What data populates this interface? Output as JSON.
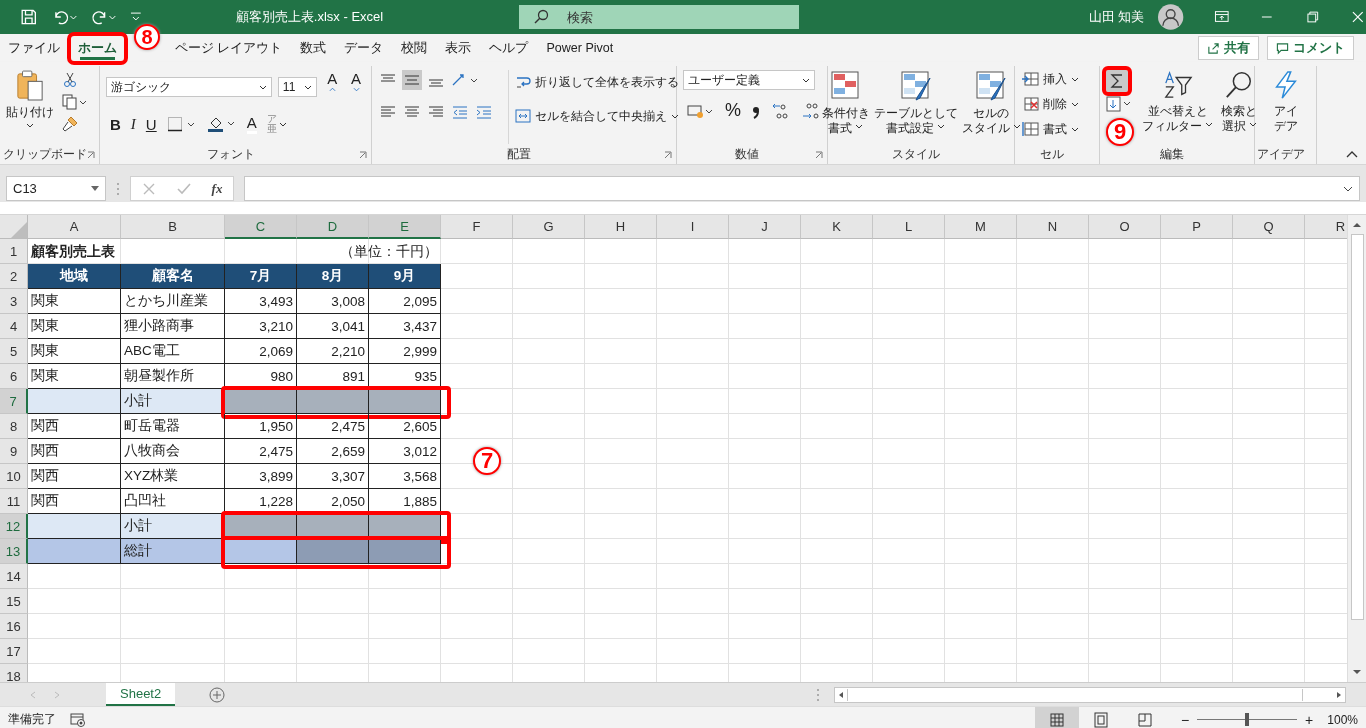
{
  "title_bar": {
    "document": "顧客別売上表.xlsx  -  Excel",
    "search": {
      "placeholder": "検索"
    },
    "user": "山田 知美"
  },
  "ribbon": {
    "tabs": [
      {
        "label": "ファイル",
        "selected": false,
        "framed": false
      },
      {
        "label": "ホーム",
        "selected": true,
        "framed": true
      },
      {
        "label": "ページ レイアウト",
        "selected": false,
        "framed": false
      },
      {
        "label": "数式",
        "selected": false,
        "framed": false
      },
      {
        "label": "データ",
        "selected": false,
        "framed": false
      },
      {
        "label": "校閲",
        "selected": false,
        "framed": false
      },
      {
        "label": "表示",
        "selected": false,
        "framed": false
      },
      {
        "label": "ヘルプ",
        "selected": false,
        "framed": false
      },
      {
        "label": "Power Pivot",
        "selected": false,
        "framed": false
      }
    ],
    "share": "共有",
    "comment": "コメント",
    "clipboard": {
      "paste": "貼り付け",
      "label": "クリップボード"
    },
    "font": {
      "name": "游ゴシック",
      "size": "11",
      "grow": "A",
      "shrink": "A",
      "bold": "B",
      "italic": "I",
      "underline": "U",
      "font_color_label": "A",
      "phonetic": [
        "ア",
        "亜"
      ],
      "label": "フォント"
    },
    "alignment": {
      "wrap": "折り返して全体を表示する",
      "merge": "セルを結合して中央揃え",
      "label": "配置"
    },
    "number": {
      "format": "ユーザー定義",
      "percent": "%",
      "label": "数値"
    },
    "styles": {
      "buttons": [
        {
          "lines": [
            "条件付き",
            "書式"
          ]
        },
        {
          "lines": [
            "テーブルとして",
            "書式設定"
          ]
        },
        {
          "lines": [
            "セルの",
            "スタイル"
          ]
        }
      ],
      "label": "スタイル"
    },
    "cells": {
      "buttons": [
        "挿入",
        "削除",
        "書式"
      ],
      "label": "セル"
    },
    "editing": {
      "autosum_framed": true,
      "sort": [
        "並べ替えと",
        "フィルター"
      ],
      "find": [
        "検索と",
        "選択"
      ],
      "label": "編集"
    },
    "ideas": {
      "lines": [
        "アイ",
        "デア"
      ],
      "label": "アイデア"
    }
  },
  "formula_bar": {
    "name_box": "C13",
    "function_label": "fx"
  },
  "sheet": {
    "columns": [
      {
        "label": "A",
        "selected": false
      },
      {
        "label": "B",
        "selected": false
      },
      {
        "label": "C",
        "selected": true
      },
      {
        "label": "D",
        "selected": true
      },
      {
        "label": "E",
        "selected": true
      },
      {
        "label": "F",
        "selected": false
      },
      {
        "label": "G",
        "selected": false
      },
      {
        "label": "H",
        "selected": false
      },
      {
        "label": "I",
        "selected": false
      },
      {
        "label": "J",
        "selected": false
      },
      {
        "label": "K",
        "selected": false
      },
      {
        "label": "L",
        "selected": false
      },
      {
        "label": "M",
        "selected": false
      },
      {
        "label": "N",
        "selected": false
      },
      {
        "label": "O",
        "selected": false
      },
      {
        "label": "P",
        "selected": false
      },
      {
        "label": "Q",
        "selected": false
      },
      {
        "label": "R",
        "selected": false
      }
    ],
    "rows": [
      {
        "num": "1",
        "kind": "title",
        "selected": false,
        "framed": false,
        "cells": [
          {
            "text": "顧客別売上表"
          },
          {},
          {},
          {},
          {
            "text": "（単位：千円）"
          }
        ]
      },
      {
        "num": "2",
        "kind": "header",
        "selected": false,
        "framed": false,
        "cells": [
          {
            "text": "地域"
          },
          {
            "text": "顧客名"
          },
          {
            "text": "7月"
          },
          {
            "text": "8月"
          },
          {
            "text": "9月"
          }
        ]
      },
      {
        "num": "3",
        "kind": "data",
        "selected": false,
        "framed": false,
        "cells": [
          {
            "text": "関東"
          },
          {
            "text": "とかち川産業"
          },
          {
            "text": "3,493"
          },
          {
            "text": "3,008"
          },
          {
            "text": "2,095"
          }
        ]
      },
      {
        "num": "4",
        "kind": "data",
        "selected": false,
        "framed": false,
        "cells": [
          {
            "text": "関東"
          },
          {
            "text": "狸小路商事"
          },
          {
            "text": "3,210"
          },
          {
            "text": "3,041"
          },
          {
            "text": "3,437"
          }
        ]
      },
      {
        "num": "5",
        "kind": "data",
        "selected": false,
        "framed": false,
        "cells": [
          {
            "text": "関東"
          },
          {
            "text": "ABC電工"
          },
          {
            "text": "2,069"
          },
          {
            "text": "2,210"
          },
          {
            "text": "2,999"
          }
        ]
      },
      {
        "num": "6",
        "kind": "data",
        "selected": false,
        "framed": false,
        "cells": [
          {
            "text": "関東"
          },
          {
            "text": "朝昼製作所"
          },
          {
            "text": "980"
          },
          {
            "text": "891"
          },
          {
            "text": "935"
          }
        ]
      },
      {
        "num": "7",
        "kind": "subtotal",
        "selected": true,
        "framed": true,
        "cells": [
          {},
          {
            "text": "小計"
          },
          {
            "selected": true,
            "active": false
          },
          {
            "selected": true,
            "active": false
          },
          {
            "selected": true,
            "active": false
          }
        ]
      },
      {
        "num": "8",
        "kind": "data",
        "selected": false,
        "framed": false,
        "cells": [
          {
            "text": "関西"
          },
          {
            "text": "町岳電器"
          },
          {
            "text": "1,950"
          },
          {
            "text": "2,475"
          },
          {
            "text": "2,605"
          }
        ]
      },
      {
        "num": "9",
        "kind": "data",
        "selected": false,
        "framed": false,
        "cells": [
          {
            "text": "関西"
          },
          {
            "text": "八牧商会"
          },
          {
            "text": "2,475"
          },
          {
            "text": "2,659"
          },
          {
            "text": "3,012"
          }
        ]
      },
      {
        "num": "10",
        "kind": "data",
        "selected": false,
        "framed": false,
        "cells": [
          {
            "text": "関西"
          },
          {
            "text": "XYZ林業"
          },
          {
            "text": "3,899"
          },
          {
            "text": "3,307"
          },
          {
            "text": "3,568"
          }
        ]
      },
      {
        "num": "11",
        "kind": "data",
        "selected": false,
        "framed": false,
        "cells": [
          {
            "text": "関西"
          },
          {
            "text": "凸凹社"
          },
          {
            "text": "1,228"
          },
          {
            "text": "2,050"
          },
          {
            "text": "1,885"
          }
        ]
      },
      {
        "num": "12",
        "kind": "subtotal",
        "selected": true,
        "framed": true,
        "cells": [
          {},
          {
            "text": "小計"
          },
          {
            "selected": true,
            "active": false
          },
          {
            "selected": true,
            "active": false
          },
          {
            "selected": true,
            "active": false
          }
        ]
      },
      {
        "num": "13",
        "kind": "total",
        "selected": true,
        "framed": true,
        "cells": [
          {},
          {
            "text": "総計"
          },
          {
            "selected": true,
            "active": true
          },
          {
            "selected": true,
            "active": false
          },
          {
            "selected": true,
            "active": false
          }
        ]
      },
      {
        "num": "14",
        "selected": false,
        "framed": false
      },
      {
        "num": "15",
        "selected": false,
        "framed": false
      },
      {
        "num": "16",
        "selected": false,
        "framed": false
      },
      {
        "num": "17",
        "selected": false,
        "framed": false
      },
      {
        "num": "18",
        "selected": false,
        "framed": false
      }
    ]
  },
  "sheet_tabs": [
    {
      "label": "Sheet2",
      "selected": true
    }
  ],
  "status_bar": {
    "status": "準備完了",
    "zoom": {
      "zoom_out": "−",
      "zoom_in": "+",
      "reading": "100%",
      "level": 0.5
    }
  },
  "callouts": [
    {
      "label": "8",
      "kind": "tab"
    },
    {
      "label": "9",
      "kind": "autosum"
    },
    {
      "label": "7",
      "kind": "sheet"
    }
  ]
}
